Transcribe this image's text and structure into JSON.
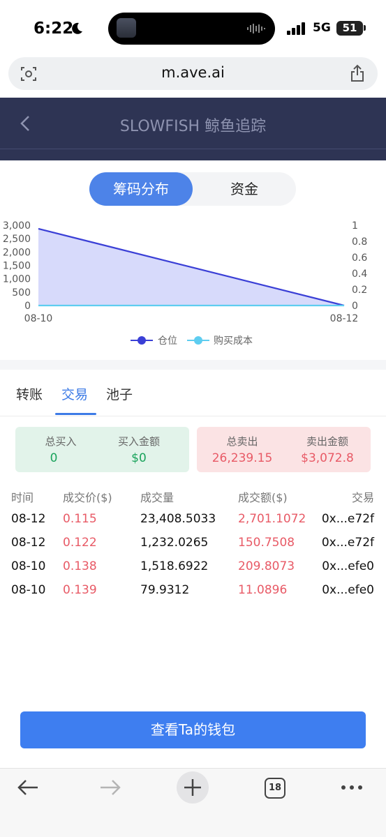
{
  "status_bar": {
    "time": "6:22",
    "network": "5G",
    "battery": "51"
  },
  "browser": {
    "url": "m.ave.ai",
    "tab_count": "18"
  },
  "header": {
    "title": "SLOWFISH 鲸鱼追踪"
  },
  "toggle": {
    "active": "筹码分布",
    "inactive": "资金"
  },
  "chart_data": {
    "type": "area",
    "x": [
      "08-10",
      "08-12"
    ],
    "y_left_ticks": [
      "3,000",
      "2,500",
      "2,000",
      "1,500",
      "1,000",
      "500",
      "0"
    ],
    "y_right_ticks": [
      "1",
      "0.8",
      "0.6",
      "0.4",
      "0.2",
      "0"
    ],
    "ylim_left": [
      0,
      3000
    ],
    "ylim_right": [
      0,
      1
    ],
    "series": [
      {
        "name": "仓位",
        "axis": "left",
        "values": [
          2870,
          0
        ],
        "color": "#3a3fd6",
        "fill": "#d3d6fb"
      },
      {
        "name": "购买成本",
        "axis": "right",
        "values": [
          0,
          0
        ],
        "color": "#5ecdf0"
      }
    ],
    "legend": "bottom"
  },
  "subtabs": [
    "转账",
    "交易",
    "池子"
  ],
  "summary": {
    "buy": {
      "total_label": "总买入",
      "total_value": "0",
      "amount_label": "买入金额",
      "amount_value": "$0"
    },
    "sell": {
      "total_label": "总卖出",
      "total_value": "26,239.15",
      "amount_label": "卖出金额",
      "amount_value": "$3,072.8"
    }
  },
  "table": {
    "headers": [
      "时间",
      "成交价($)",
      "成交量",
      "成交额($)",
      "交易"
    ],
    "rows": [
      [
        "08-12",
        "0.115",
        "23,408.5033",
        "2,701.1072",
        "0x...e72f"
      ],
      [
        "08-12",
        "0.122",
        "1,232.0265",
        "150.7508",
        "0x...e72f"
      ],
      [
        "08-10",
        "0.138",
        "1,518.6922",
        "209.8073",
        "0x...efe0"
      ],
      [
        "08-10",
        "0.139",
        "79.9312",
        "11.0896",
        "0x...efe0"
      ]
    ]
  },
  "wallet_button": "查看Ta的钱包"
}
